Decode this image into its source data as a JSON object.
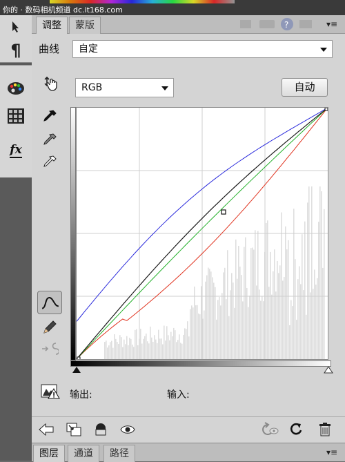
{
  "window": {
    "title_strip_text": "你的 · 数码相机频道 dc.it168.com"
  },
  "toolbar": {
    "icons": [
      "arrow-icon",
      "paragraph-icon",
      "palette-icon",
      "swatches-icon",
      "fx-icon"
    ],
    "paragraph_glyph": "¶",
    "fx_glyph": "fx"
  },
  "panel": {
    "tabs": [
      {
        "label": "调整"
      },
      {
        "label": "蒙版"
      }
    ],
    "menu_glyph": "▾≡"
  },
  "curves": {
    "title_label": "曲线",
    "preset_value": "自定",
    "channel_value": "RGB",
    "auto_button_label": "自动",
    "output_label": "输出:",
    "input_label": "输入:",
    "colors": {
      "rgb": "#1a1a1a",
      "red": "#e0321e",
      "green": "#23b02a",
      "blue": "#2b2bdc",
      "histogram": "#dedede",
      "grid": "#cfcfcf"
    }
  },
  "bottom_tabs": [
    {
      "label": "图层"
    },
    {
      "label": "通道"
    },
    {
      "label": "路径"
    }
  ],
  "bottom_menu_glyph": "▾≡"
}
